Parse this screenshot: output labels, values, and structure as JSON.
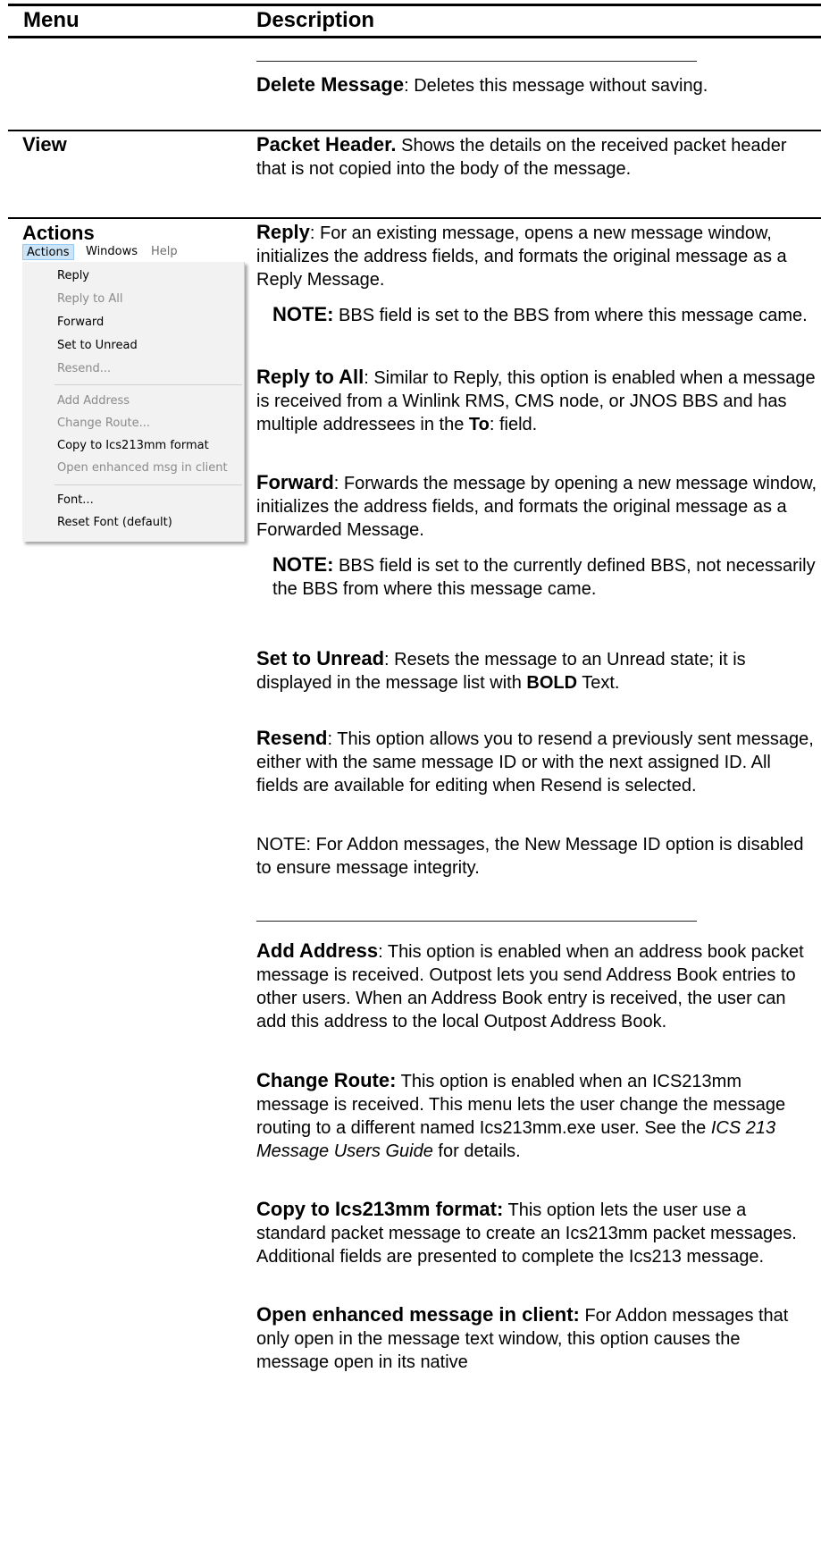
{
  "header": {
    "menu": "Menu",
    "description": "Description"
  },
  "top": {
    "delete_title": "Delete Message",
    "delete_text": ": Deletes this message without saving."
  },
  "view": {
    "label": "View",
    "title": "Packet Header.",
    "text": "  Shows the details on the received packet header that is not copied into the body of the message."
  },
  "actions": {
    "label": "Actions",
    "menubar": [
      "Actions",
      "Windows",
      "Help"
    ],
    "menu_items": [
      {
        "label": "Reply",
        "enabled": true
      },
      {
        "label": "Reply to All",
        "enabled": false
      },
      {
        "label": "Forward",
        "enabled": true
      },
      {
        "label": "Set to Unread",
        "enabled": true
      },
      {
        "label": "Resend...",
        "enabled": false
      },
      {
        "label": "Add Address",
        "enabled": false
      },
      {
        "label": "Change Route...",
        "enabled": false
      },
      {
        "label": "Copy to Ics213mm format",
        "enabled": true
      },
      {
        "label": "Open enhanced msg in client",
        "enabled": false
      },
      {
        "label": "Font...",
        "enabled": true
      },
      {
        "label": "Reset Font (default)",
        "enabled": true
      }
    ],
    "reply": {
      "title": "Reply",
      "text": ":  For an existing message, opens a new message window, initializes the address fields, and formats the original message as a Reply Message."
    },
    "reply_note": {
      "prefix": "NOTE:",
      "text": " BBS field is set to the BBS from where this message came."
    },
    "reply_all": {
      "title": "Reply to All",
      "text1": ":  Similar to Reply, this option is enabled when a message is received from a Winlink RMS, CMS node, or JNOS BBS and has multiple addressees in the ",
      "bold": "To",
      "text2": ": field."
    },
    "forward": {
      "title": "Forward",
      "text": ":  Forwards the message by opening a new message window, initializes the address fields, and formats the original message as a Forwarded Message."
    },
    "forward_note": {
      "prefix": "NOTE:",
      "text": " BBS field is set to the currently defined BBS, not necessarily the BBS from where this message came."
    },
    "unread": {
      "title": "Set to Unread",
      "text1": ":  Resets the message to an Unread state; it is displayed in the message list with ",
      "bold": "BOLD",
      "text2": " Text."
    },
    "resend": {
      "title": "Resend",
      "text": ":  This option allows you to resend a previously sent message, either with the same message ID or with the next assigned ID.  All fields are available for editing when Resend is selected."
    },
    "resend_note": "NOTE: For Addon messages, the New Message ID option is disabled to ensure message integrity.",
    "add_address": {
      "title": "Add Address",
      "text": ":  This option is enabled when an address book packet message is received.  Outpost lets you send Address Book entries to other users.  When an Address Book entry is received, the user can add this address to the local Outpost Address Book."
    },
    "change_route": {
      "title": "Change Route:",
      "text1": " This option is enabled when an ICS213mm message is received.  This menu lets the user change the message routing to a different named Ics213mm.exe user.  See the ",
      "italic": "ICS 213 Message Users Guide",
      "text2": " for details."
    },
    "copy": {
      "title": "Copy to Ics213mm format:",
      "text": " This option lets the user use a standard packet message to create an Ics213mm packet messages.  Additional fields are presented to complete the Ics213 message."
    },
    "open_enhanced": {
      "title": "Open enhanced message in client:",
      "text": " For Addon messages that only open in the message text window, this option causes the message open in its native"
    }
  }
}
